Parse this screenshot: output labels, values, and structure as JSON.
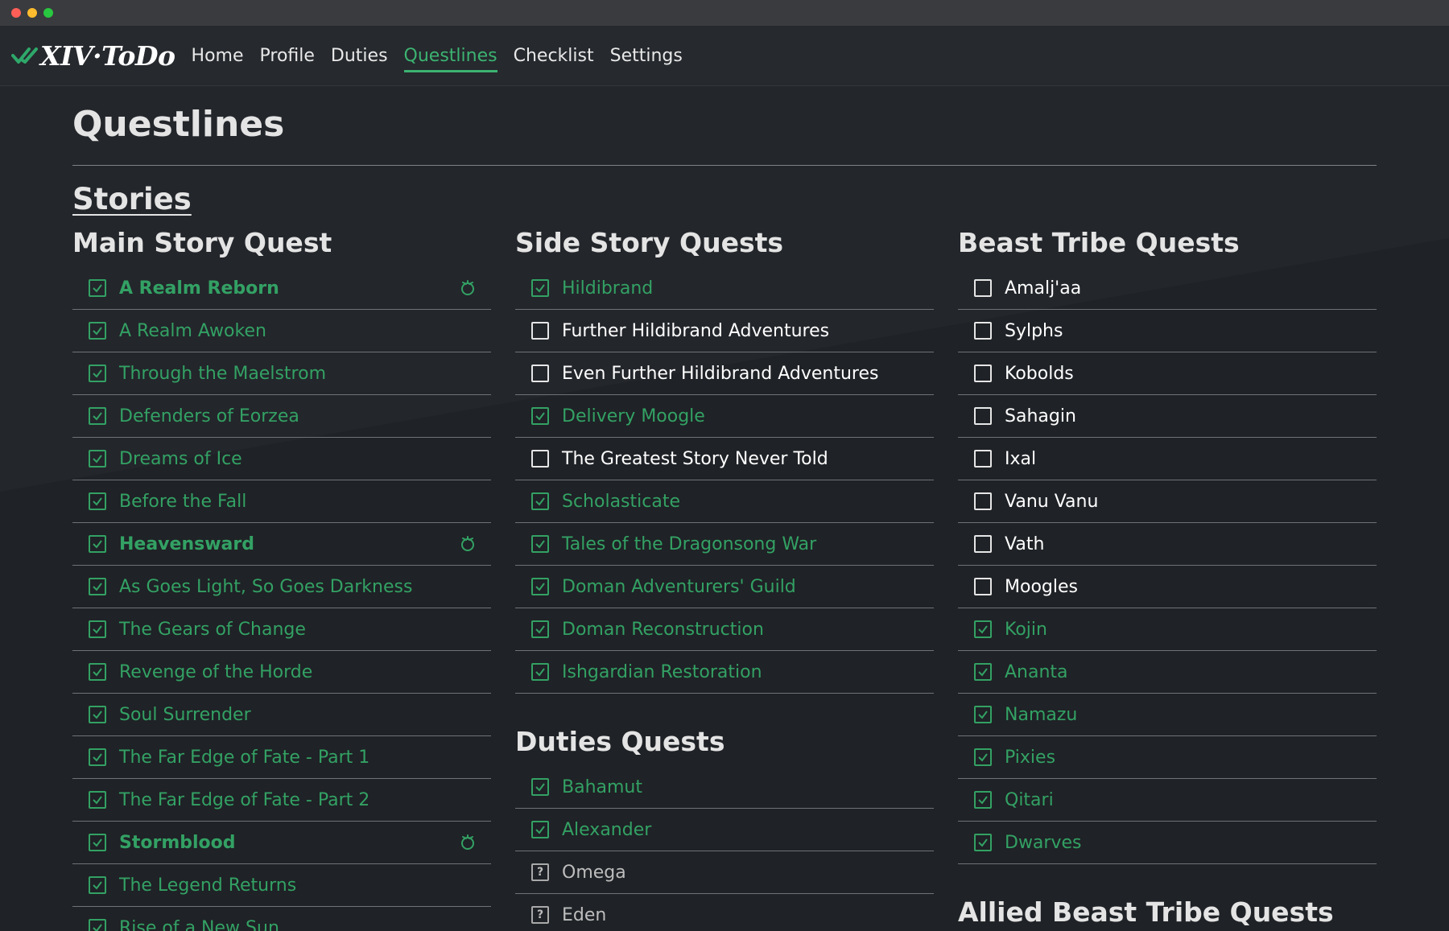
{
  "window": {
    "title": "XIV·ToDo"
  },
  "nav": {
    "brand": "XIV·ToDo",
    "links": [
      "Home",
      "Profile",
      "Duties",
      "Questlines",
      "Checklist",
      "Settings"
    ],
    "active": "Questlines"
  },
  "page": {
    "title": "Questlines",
    "section": "Stories"
  },
  "colors": {
    "done": "#33a164",
    "accent": "#3cb371",
    "background": "#1f2226",
    "navbar": "#26292e"
  },
  "main_story": {
    "title": "Main Story Quest",
    "items": [
      {
        "label": "A Realm Reborn",
        "state": "done",
        "expansion": true,
        "icon": "expansion-icon"
      },
      {
        "label": "A Realm Awoken",
        "state": "done"
      },
      {
        "label": "Through the Maelstrom",
        "state": "done"
      },
      {
        "label": "Defenders of Eorzea",
        "state": "done"
      },
      {
        "label": "Dreams of Ice",
        "state": "done"
      },
      {
        "label": "Before the Fall",
        "state": "done"
      },
      {
        "label": "Heavensward",
        "state": "done",
        "expansion": true,
        "icon": "expansion-icon"
      },
      {
        "label": "As Goes Light, So Goes Darkness",
        "state": "done"
      },
      {
        "label": "The Gears of Change",
        "state": "done"
      },
      {
        "label": "Revenge of the Horde",
        "state": "done"
      },
      {
        "label": "Soul Surrender",
        "state": "done"
      },
      {
        "label": "The Far Edge of Fate - Part 1",
        "state": "done"
      },
      {
        "label": "The Far Edge of Fate - Part 2",
        "state": "done"
      },
      {
        "label": "Stormblood",
        "state": "done",
        "expansion": true,
        "icon": "expansion-icon"
      },
      {
        "label": "The Legend Returns",
        "state": "done"
      },
      {
        "label": "Rise of a New Sun",
        "state": "done"
      }
    ]
  },
  "side_story": {
    "title": "Side Story Quests",
    "items": [
      {
        "label": "Hildibrand",
        "state": "done"
      },
      {
        "label": "Further Hildibrand Adventures",
        "state": "todo"
      },
      {
        "label": "Even Further Hildibrand Adventures",
        "state": "todo"
      },
      {
        "label": "Delivery Moogle",
        "state": "done"
      },
      {
        "label": "The Greatest Story Never Told",
        "state": "todo"
      },
      {
        "label": "Scholasticate",
        "state": "done"
      },
      {
        "label": "Tales of the Dragonsong War",
        "state": "done"
      },
      {
        "label": "Doman Adventurers' Guild",
        "state": "done"
      },
      {
        "label": "Doman Reconstruction",
        "state": "done"
      },
      {
        "label": "Ishgardian Restoration",
        "state": "done"
      }
    ]
  },
  "duties_quests": {
    "title": "Duties Quests",
    "items": [
      {
        "label": "Bahamut",
        "state": "done"
      },
      {
        "label": "Alexander",
        "state": "done"
      },
      {
        "label": "Omega",
        "state": "unknown",
        "mark": "?"
      },
      {
        "label": "Eden",
        "state": "unknown",
        "mark": "?"
      }
    ]
  },
  "beast_tribe": {
    "title": "Beast Tribe Quests",
    "items": [
      {
        "label": "Amalj'aa",
        "state": "todo"
      },
      {
        "label": "Sylphs",
        "state": "todo"
      },
      {
        "label": "Kobolds",
        "state": "todo"
      },
      {
        "label": "Sahagin",
        "state": "todo"
      },
      {
        "label": "Ixal",
        "state": "todo"
      },
      {
        "label": "Vanu Vanu",
        "state": "todo"
      },
      {
        "label": "Vath",
        "state": "todo"
      },
      {
        "label": "Moogles",
        "state": "todo"
      },
      {
        "label": "Kojin",
        "state": "done"
      },
      {
        "label": "Ananta",
        "state": "done"
      },
      {
        "label": "Namazu",
        "state": "done"
      },
      {
        "label": "Pixies",
        "state": "done"
      },
      {
        "label": "Qitari",
        "state": "done"
      },
      {
        "label": "Dwarves",
        "state": "done"
      }
    ]
  },
  "allied_beast_tribe": {
    "title": "Allied Beast Tribe Quests"
  }
}
